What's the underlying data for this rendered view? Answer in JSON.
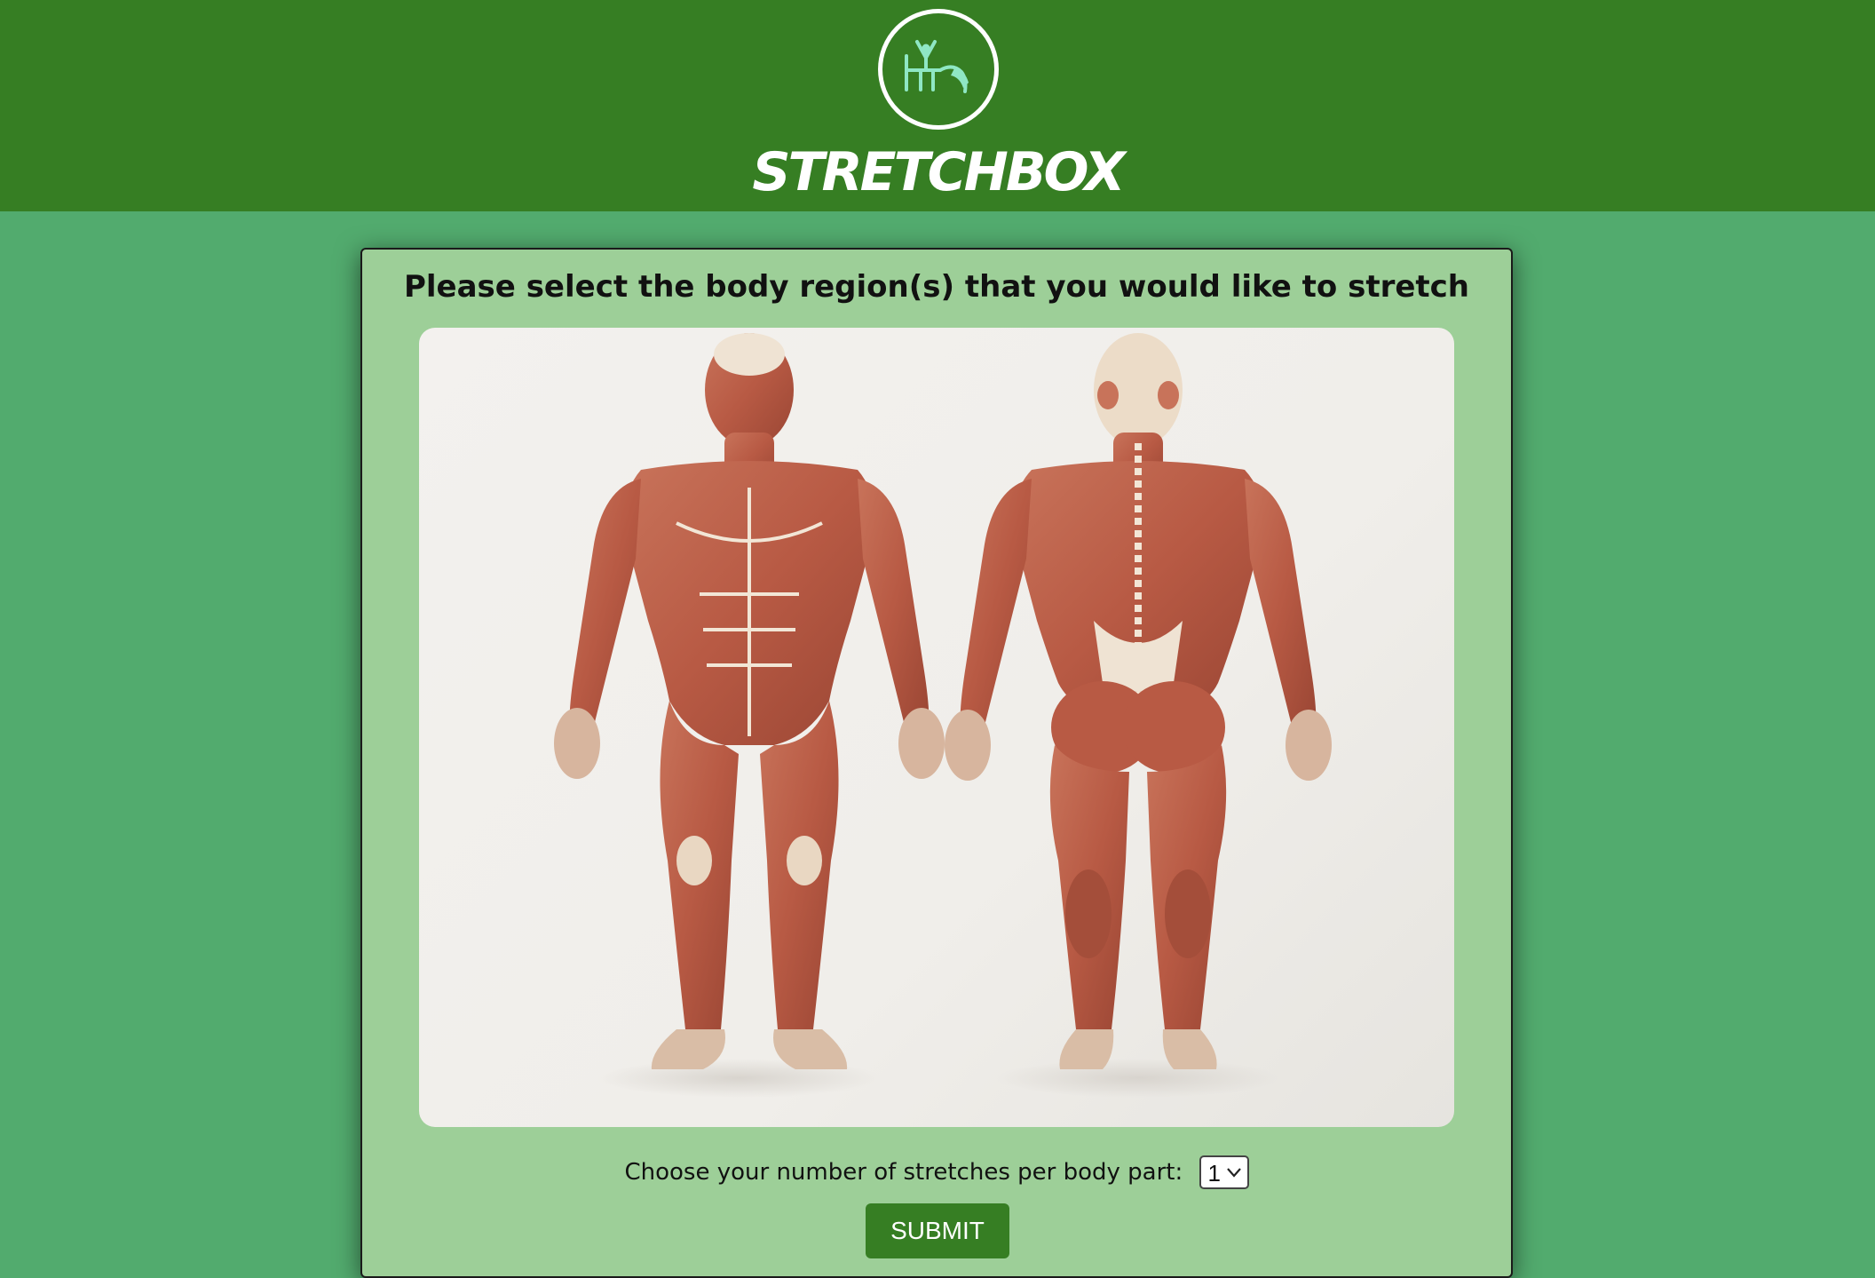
{
  "header": {
    "logo_icon": "stretching-person-icon",
    "brand": "STRETCHBOX"
  },
  "form": {
    "title": "Please select the body region(s) that you would like to stretch",
    "count_label": "Choose your number of stretches per body part:",
    "count_value": "1",
    "submit_label": "SUBMIT"
  },
  "colors": {
    "header_bg": "#367e23",
    "page_bg": "#52ab6e",
    "card_bg": "#9dcf98",
    "logo_accent": "#8fe7c4"
  }
}
